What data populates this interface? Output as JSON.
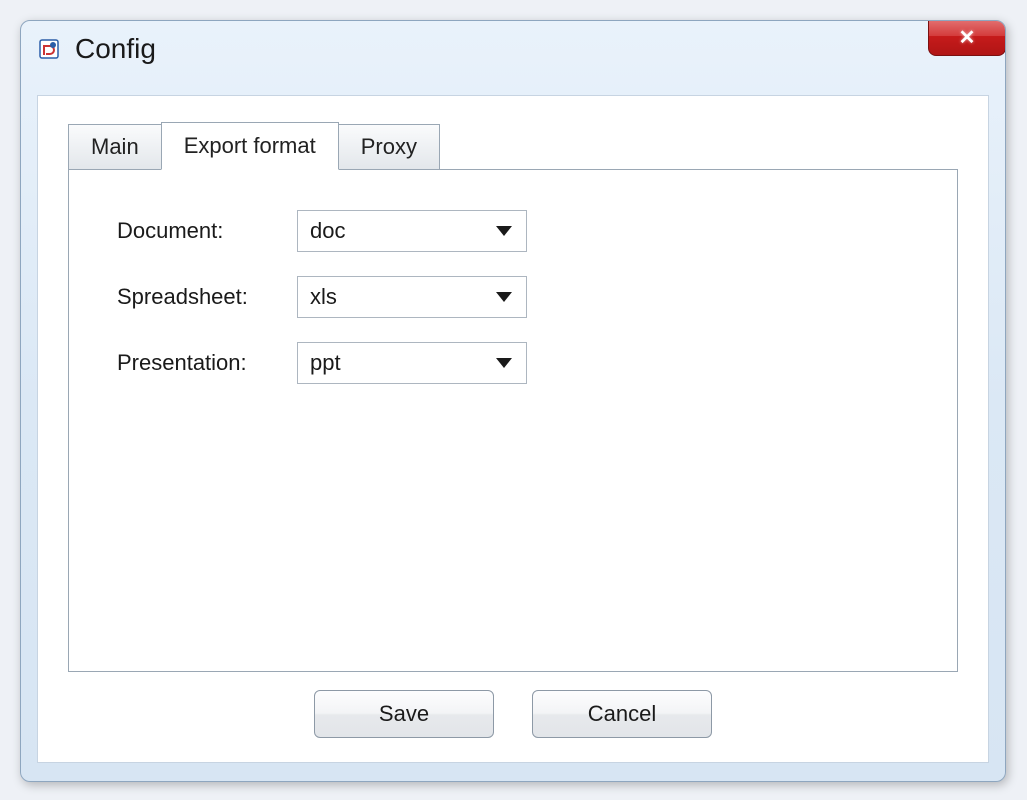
{
  "window": {
    "title": "Config"
  },
  "tabs": {
    "main": "Main",
    "export_format": "Export format",
    "proxy": "Proxy",
    "active": "export_format"
  },
  "form": {
    "document": {
      "label": "Document:",
      "value": "doc"
    },
    "spreadsheet": {
      "label": "Spreadsheet:",
      "value": "xls"
    },
    "presentation": {
      "label": "Presentation:",
      "value": "ppt"
    }
  },
  "buttons": {
    "save": "Save",
    "cancel": "Cancel"
  }
}
